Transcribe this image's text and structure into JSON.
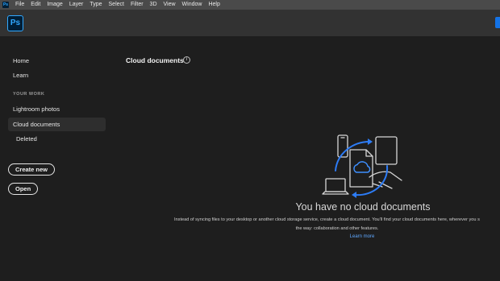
{
  "menubar": {
    "icon": "Ps",
    "items": [
      "File",
      "Edit",
      "Image",
      "Layer",
      "Type",
      "Select",
      "Filter",
      "3D",
      "View",
      "Window",
      "Help"
    ]
  },
  "header": {
    "logo": "Ps"
  },
  "sidebar": {
    "home": "Home",
    "learn": "Learn",
    "section": "YOUR WORK",
    "lightroom": "Lightroom photos",
    "cloud": "Cloud documents",
    "deleted": "Deleted",
    "create_new": "Create new",
    "open": "Open"
  },
  "main": {
    "title": "Cloud documents",
    "info_icon": "i",
    "empty_heading": "You have no cloud documents",
    "empty_line1": "Instead of syncing files to your desktop or another cloud storage service, create a cloud document. You'll find your cloud documents here, wherever you s",
    "empty_line2": "the way: collaboration and other features.",
    "learn_more": "Learn more"
  },
  "colors": {
    "accent": "#1473e6",
    "link": "#5fa8ff",
    "ps_blue": "#31a8ff"
  }
}
